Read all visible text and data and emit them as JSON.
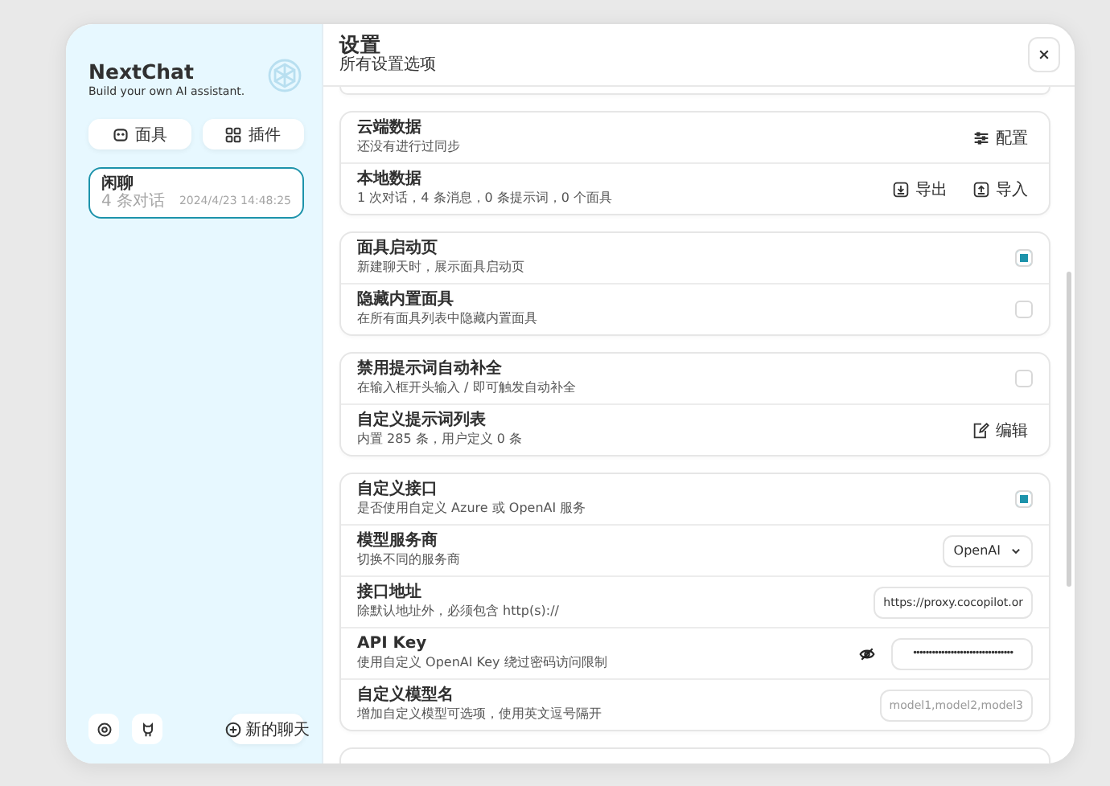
{
  "sidebar": {
    "title": "NextChat",
    "subtitle": "Build your own AI assistant.",
    "buttons": [
      {
        "label": "面具",
        "kind": "masks"
      },
      {
        "label": "插件",
        "kind": "plugins"
      }
    ],
    "chats": [
      {
        "title": "闲聊",
        "count": "4 条对话",
        "time": "2024/4/23 14:48:25",
        "selected": true
      }
    ],
    "footer_buttons": [
      {
        "kind": "settings"
      },
      {
        "kind": "github"
      }
    ],
    "new_chat": "新的聊天"
  },
  "header": {
    "title": "设置",
    "subtitle": "所有设置选项"
  },
  "groups": [
    {
      "rows": [
        {
          "kind": "action",
          "title": "云端数据",
          "subtitle": "还没有进行过同步",
          "actions": [
            {
              "label": "配置",
              "kind": "sync"
            }
          ]
        },
        {
          "kind": "action",
          "title": "本地数据",
          "subtitle": "1 次对话，4 条消息，0 条提示词，0 个面具",
          "actions": [
            {
              "label": "导出",
              "kind": "export"
            },
            {
              "label": "导入",
              "kind": "import"
            }
          ]
        }
      ]
    },
    {
      "rows": [
        {
          "kind": "checkbox",
          "title": "面具启动页",
          "subtitle": "新建聊天时，展示面具启动页",
          "checked": true
        },
        {
          "kind": "checkbox",
          "title": "隐藏内置面具",
          "subtitle": "在所有面具列表中隐藏内置面具",
          "checked": false
        }
      ]
    },
    {
      "rows": [
        {
          "kind": "checkbox",
          "title": "禁用提示词自动补全",
          "subtitle": "在输入框开头输入 / 即可触发自动补全",
          "checked": false
        },
        {
          "kind": "action",
          "title": "自定义提示词列表",
          "subtitle": "内置 285 条，用户定义 0 条",
          "actions": [
            {
              "label": "编辑",
              "kind": "edit"
            }
          ]
        }
      ]
    },
    {
      "rows": [
        {
          "kind": "checkbox",
          "title": "自定义接口",
          "subtitle": "是否使用自定义 Azure 或 OpenAI 服务",
          "checked": true
        },
        {
          "kind": "select",
          "title": "模型服务商",
          "subtitle": "切换不同的服务商",
          "value": "OpenAI"
        },
        {
          "kind": "input",
          "title": "接口地址",
          "subtitle": "除默认地址外，必须包含 http(s)://",
          "value": "https://proxy.cocopilot.or"
        },
        {
          "kind": "password",
          "title": "API Key",
          "subtitle": "使用自定义 OpenAI Key 绕过密码访问限制",
          "value": "••••••••••••••••••••••••••••••••"
        },
        {
          "kind": "input",
          "title": "自定义模型名",
          "subtitle": "增加自定义模型可选项，使用英文逗号隔开",
          "placeholder": "model1,model2,model3"
        }
      ]
    }
  ]
}
